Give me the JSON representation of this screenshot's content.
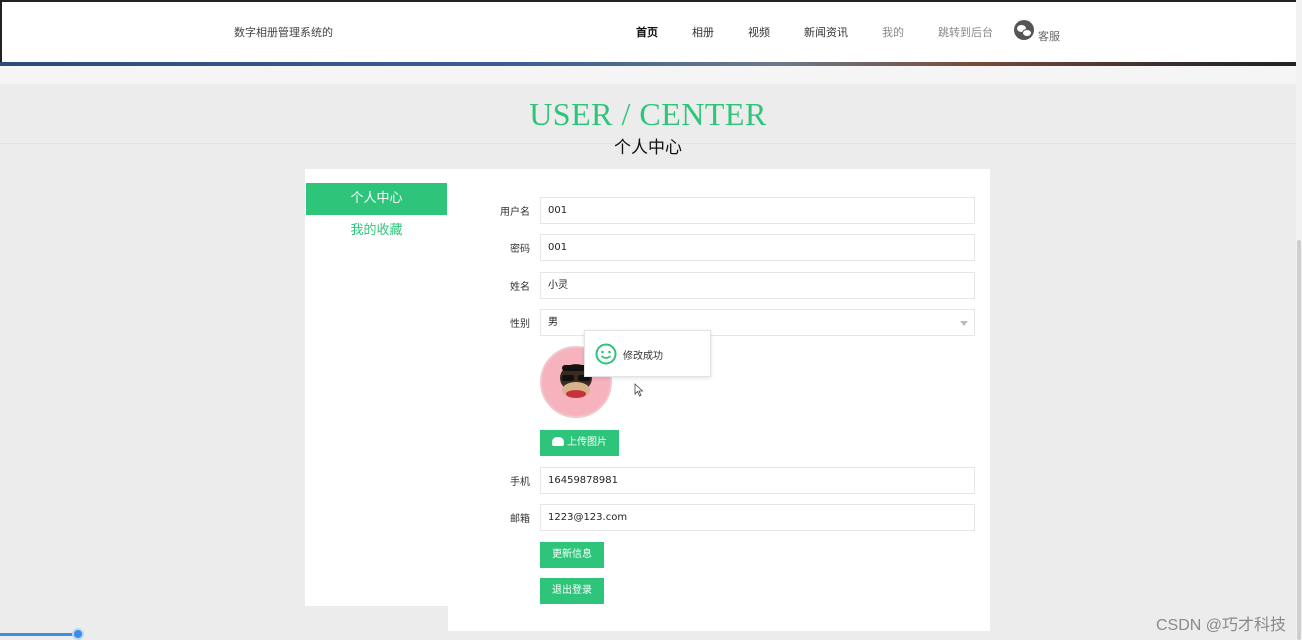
{
  "header": {
    "site_title": "数字相册管理系统的",
    "nav": [
      "首页",
      "相册",
      "视频",
      "新闻资讯",
      "我的",
      "跳转到后台"
    ],
    "customer_service": "客服"
  },
  "page": {
    "title_en": "USER / CENTER",
    "title_cn": "个人中心"
  },
  "sidebar": {
    "items": [
      {
        "label": "个人中心"
      },
      {
        "label": "我的收藏"
      }
    ]
  },
  "form": {
    "username": {
      "label": "用户名",
      "value": "001"
    },
    "password": {
      "label": "密码",
      "value": "001"
    },
    "name": {
      "label": "姓名",
      "value": "小灵"
    },
    "gender": {
      "label": "性别",
      "value": "男"
    },
    "upload_label": "上传图片",
    "phone": {
      "label": "手机",
      "value": "16459878981"
    },
    "email": {
      "label": "邮箱",
      "value": "1223@123.com"
    },
    "update_label": "更新信息",
    "logout_label": "退出登录"
  },
  "toast": {
    "message": "修改成功"
  },
  "watermark": "CSDN @巧才科技",
  "colors": {
    "accent": "#2ec57b",
    "background": "#ececec"
  }
}
